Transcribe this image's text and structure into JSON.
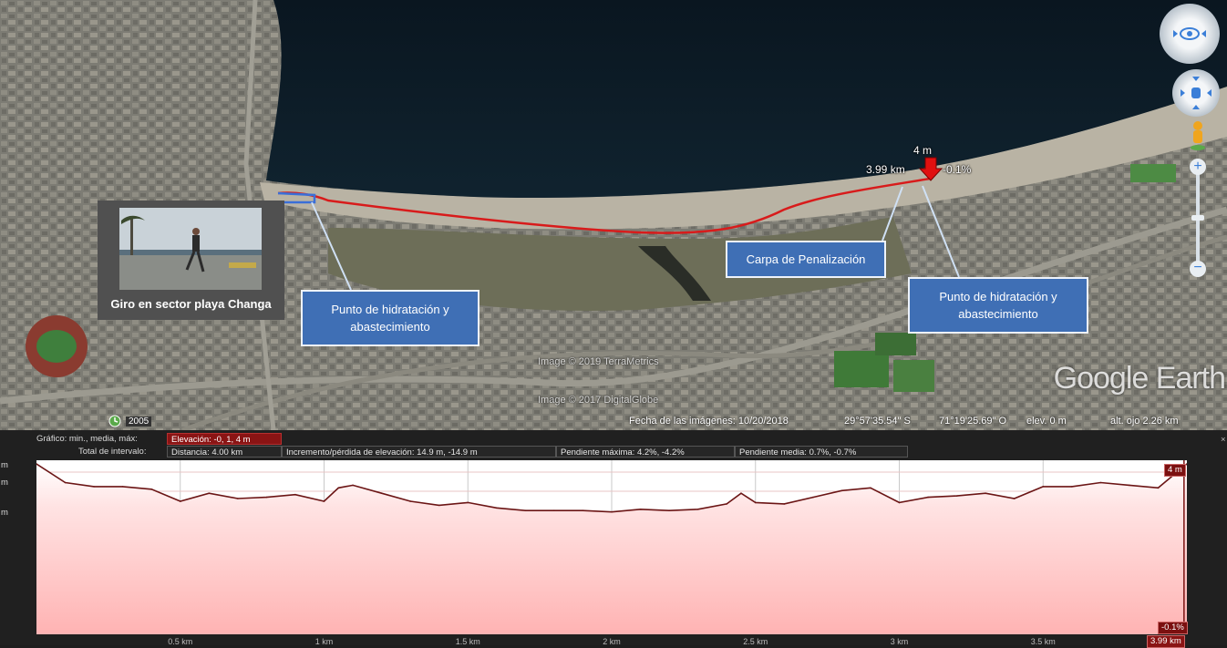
{
  "map": {
    "marker_elevation": "4 m",
    "marker_distance": "3.99 km",
    "marker_slope": "-0.1%",
    "photo_caption": "Giro en sector playa Changa",
    "callouts": {
      "hydration_left": "Punto de hidratación y abastecimiento",
      "penalty_tent": "Carpa  de Penalización",
      "hydration_right": "Punto de hidratación y abastecimiento"
    },
    "credits": [
      "Image © 2019 TerraMetrics",
      "Image © 2017 DigitalGlobe"
    ],
    "logo": "Google Earth",
    "history_year": "2005",
    "status": {
      "date": "Fecha de las imágenes: 10/20/2018",
      "lat": "29°57'35.54\" S",
      "lon": "71°19'25.69\" O",
      "elev": "elev.    0 m",
      "eye_alt": "alt. ojo   2.26 km"
    },
    "route_color": "#d81b1b",
    "water_color": "#0b1a26"
  },
  "profile": {
    "row1_label": "Gráfico: min., media, máx:",
    "elevation_stat": "Elevación: -0, 1, 4 m",
    "row2_label": "Total de intervalo:",
    "distance_stat": "Distancia: 4.00 km",
    "gain_stat": "Incremento/pérdida de elevación: 14.9 m, -14.9 m",
    "max_slope_stat": "Pendiente máxima: 4.2%, -4.2%",
    "avg_slope_stat": "Pendiente media: 0.7%, -0.7%",
    "y_axis_unit_labels": [
      "m",
      "m",
      "m"
    ],
    "current_elev_badge": "4 m",
    "current_slope_badge": "-0.1%",
    "current_distance_badge": "3.99 km",
    "x_ticks": [
      "0.5 km",
      "1 km",
      "1.5 km",
      "2 km",
      "2.5 km",
      "3 km",
      "3.5 km"
    ],
    "chart_data": {
      "type": "area",
      "x": [
        0,
        0.1,
        0.2,
        0.3,
        0.4,
        0.5,
        0.6,
        0.7,
        0.8,
        0.9,
        1.0,
        1.05,
        1.1,
        1.2,
        1.3,
        1.4,
        1.5,
        1.6,
        1.7,
        1.8,
        1.9,
        2.0,
        2.1,
        2.2,
        2.3,
        2.4,
        2.45,
        2.5,
        2.6,
        2.7,
        2.8,
        2.9,
        3.0,
        3.1,
        3.2,
        3.3,
        3.4,
        3.5,
        3.6,
        3.7,
        3.8,
        3.9,
        4.0
      ],
      "values": [
        4,
        2.6,
        2.3,
        2.3,
        2.1,
        1.2,
        1.8,
        1.4,
        1.5,
        1.7,
        1.2,
        2.2,
        2.4,
        1.8,
        1.2,
        0.9,
        1.1,
        0.7,
        0.5,
        0.5,
        0.5,
        0.4,
        0.6,
        0.5,
        0.6,
        1.0,
        1.8,
        1.1,
        1.0,
        1.5,
        2.0,
        2.2,
        1.1,
        1.5,
        1.6,
        1.8,
        1.4,
        2.3,
        2.3,
        2.6,
        2.4,
        2.2,
        4
      ],
      "xlabel": "",
      "ylabel": "",
      "xlim": [
        0,
        4.0
      ],
      "ylim": [
        -0.1,
        4
      ],
      "grid": true,
      "fill_color": "#ffb3b3",
      "line_color": "#6b1515"
    }
  }
}
